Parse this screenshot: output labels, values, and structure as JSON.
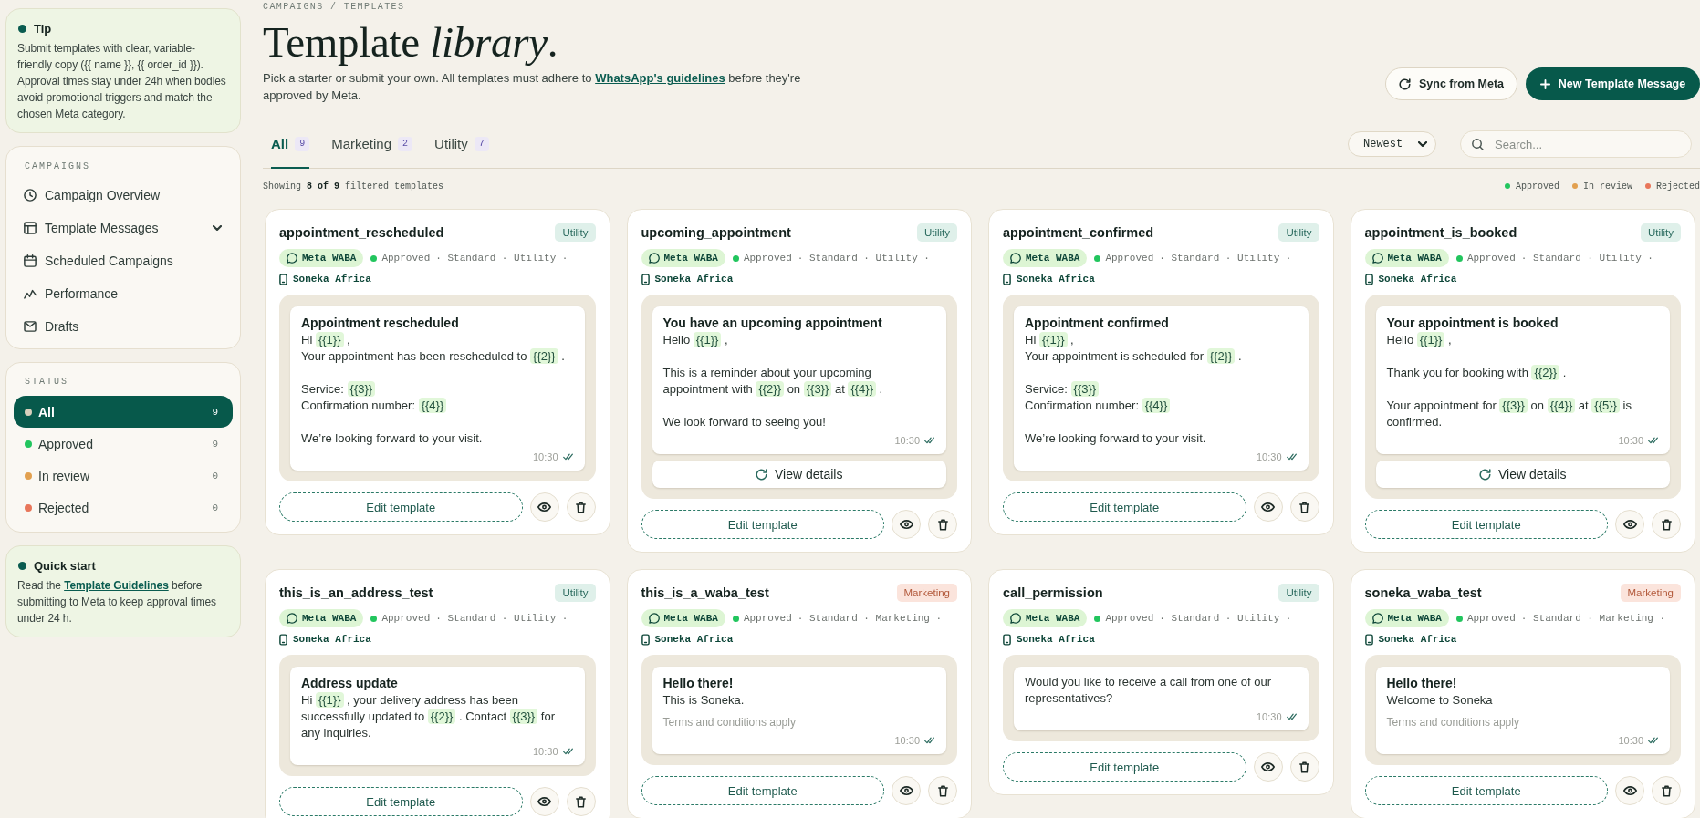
{
  "sidebar": {
    "tip": {
      "title": "Tip",
      "text": "Submit templates with clear, variable-friendly copy ({{ name }}, {{ order_id }}). Approval times stay under 24h when bodies avoid promotional triggers and match the chosen Meta category."
    },
    "campaigns": {
      "heading": "CAMPAIGNS",
      "items": [
        {
          "label": "Campaign Overview",
          "kind": "link"
        },
        {
          "label": "Template Messages",
          "kind": "group"
        },
        {
          "label": "Scheduled Campaigns",
          "kind": "link"
        },
        {
          "label": "Performance",
          "kind": "link"
        },
        {
          "label": "Drafts",
          "kind": "link"
        }
      ]
    },
    "status": {
      "heading": "STATUS",
      "items": [
        {
          "label": "All",
          "count": "9",
          "color": "#d8cfbb",
          "selected": true
        },
        {
          "label": "Approved",
          "count": "9",
          "color": "#22c55e",
          "selected": false
        },
        {
          "label": "In review",
          "count": "0",
          "color": "#e2a04f",
          "selected": false
        },
        {
          "label": "Rejected",
          "count": "0",
          "color": "#e8765a",
          "selected": false
        }
      ]
    },
    "quick_start": {
      "title": "Quick start",
      "before": "Read the",
      "link": "Template Guidelines",
      "after": "before submitting to Meta to keep approval times under 24 h."
    }
  },
  "header": {
    "breadcrumb": "CAMPAIGNS / TEMPLATES",
    "title": "Template *library*.",
    "description": {
      "before": "Pick a starter or submit your own. All templates must adhere to",
      "link": "WhatsApp's guidelines",
      "after": "before they're approved by Meta."
    },
    "buttons": [
      {
        "label": "Sync from Meta",
        "kind": "secondary"
      },
      {
        "label": "New Template Message",
        "kind": "primary"
      }
    ]
  },
  "tabs": [
    {
      "label": "All",
      "count": "9",
      "selected": true
    },
    {
      "label": "Marketing",
      "count": "2",
      "selected": false
    },
    {
      "label": "Utility",
      "count": "7",
      "selected": false
    }
  ],
  "sort": {
    "value": "Newest"
  },
  "search": {
    "placeholder": "Search..."
  },
  "summary": "Showing **8 of 9** filtered templates",
  "legend": [
    {
      "label": "Approved",
      "color": "#22c55e"
    },
    {
      "label": "In review",
      "color": "#e2a04f"
    },
    {
      "label": "Rejected",
      "color": "#e8765a"
    }
  ],
  "cards": [
    {
      "name": "appointment_rescheduled",
      "tag": {
        "label": "Utility",
        "kind": "utility"
      },
      "channel": "Meta WABA",
      "status": {
        "label": "Approved",
        "color": "#22c55e"
      },
      "details": "· Standard · Utility ·",
      "account": "Soneka Africa",
      "message": {
        "header": "Appointment rescheduled",
        "body": [
          [
            [
              "Hi ",
              {
                "var": "{{1}}"
              },
              " ,"
            ],
            [
              "Your appointment has been rescheduled to ",
              {
                "var": "{{2}}"
              },
              " ."
            ]
          ],
          [
            [
              "Service: ",
              {
                "var": "{{3}}"
              }
            ],
            [
              "Confirmation number: ",
              {
                "var": "{{4}}"
              }
            ]
          ],
          [
            [
              "We’re looking forward to your visit."
            ]
          ]
        ],
        "time": "10:30"
      },
      "edit_label": "Edit template"
    },
    {
      "name": "upcoming_appointment",
      "tag": {
        "label": "Utility",
        "kind": "utility"
      },
      "channel": "Meta WABA",
      "status": {
        "label": "Approved",
        "color": "#22c55e"
      },
      "details": "· Standard · Utility ·",
      "account": "Soneka Africa",
      "message": {
        "header": "You have an upcoming appointment",
        "body": [
          [
            [
              "Hello ",
              {
                "var": "{{1}}"
              },
              " ,"
            ]
          ],
          [
            [
              "This is a reminder about your upcoming appointment with ",
              {
                "var": "{{2}}"
              },
              " on ",
              {
                "var": "{{3}}"
              },
              " at ",
              {
                "var": "{{4}}"
              },
              " ."
            ]
          ],
          [
            [
              "We look forward to seeing you!"
            ]
          ]
        ],
        "time": "10:30",
        "button": "View details"
      },
      "edit_label": "Edit template"
    },
    {
      "name": "appointment_confirmed",
      "tag": {
        "label": "Utility",
        "kind": "utility"
      },
      "channel": "Meta WABA",
      "status": {
        "label": "Approved",
        "color": "#22c55e"
      },
      "details": "· Standard · Utility ·",
      "account": "Soneka Africa",
      "message": {
        "header": "Appointment confirmed",
        "body": [
          [
            [
              "Hi ",
              {
                "var": "{{1}}"
              },
              " ,"
            ],
            [
              "Your appointment is scheduled for ",
              {
                "var": "{{2}}"
              },
              " ."
            ]
          ],
          [
            [
              "Service: ",
              {
                "var": "{{3}}"
              }
            ],
            [
              "Confirmation number: ",
              {
                "var": "{{4}}"
              }
            ]
          ],
          [
            [
              "We’re looking forward to your visit."
            ]
          ]
        ],
        "time": "10:30"
      },
      "edit_label": "Edit template"
    },
    {
      "name": "appointment_is_booked",
      "tag": {
        "label": "Utility",
        "kind": "utility"
      },
      "channel": "Meta WABA",
      "status": {
        "label": "Approved",
        "color": "#22c55e"
      },
      "details": "· Standard · Utility ·",
      "account": "Soneka Africa",
      "message": {
        "header": "Your appointment is booked",
        "body": [
          [
            [
              "Hello ",
              {
                "var": "{{1}}"
              },
              " ,"
            ]
          ],
          [
            [
              "Thank you for booking with ",
              {
                "var": "{{2}}"
              },
              " ."
            ]
          ],
          [
            [
              "Your appointment for ",
              {
                "var": "{{3}}"
              },
              " on ",
              {
                "var": "{{4}}"
              },
              " at ",
              {
                "var": "{{5}}"
              },
              " is confirmed."
            ]
          ]
        ],
        "time": "10:30",
        "button": "View details"
      },
      "edit_label": "Edit template"
    },
    {
      "name": "this_is_an_address_test",
      "tag": {
        "label": "Utility",
        "kind": "utility"
      },
      "channel": "Meta WABA",
      "status": {
        "label": "Approved",
        "color": "#22c55e"
      },
      "details": "· Standard · Utility ·",
      "account": "Soneka Africa",
      "message": {
        "header": "Address update",
        "body": [
          [
            [
              "Hi ",
              {
                "var": "{{1}}"
              },
              " , your delivery address has been successfully updated to ",
              {
                "var": "{{2}}"
              },
              " . Contact ",
              {
                "var": "{{3}}"
              },
              " for any inquiries."
            ]
          ]
        ],
        "time": "10:30"
      },
      "edit_label": "Edit template"
    },
    {
      "name": "this_is_a_waba_test",
      "tag": {
        "label": "Marketing",
        "kind": "marketing"
      },
      "channel": "Meta WABA",
      "status": {
        "label": "Approved",
        "color": "#22c55e"
      },
      "details": "· Standard · Marketing ·",
      "account": "Soneka Africa",
      "message": {
        "header": "Hello there!",
        "body": [
          [
            [
              "This is Soneka."
            ]
          ]
        ],
        "footer": "Terms and conditions apply",
        "time": "10:30"
      },
      "edit_label": "Edit template"
    },
    {
      "name": "call_permission",
      "tag": {
        "label": "Utility",
        "kind": "utility"
      },
      "channel": "Meta WABA",
      "status": {
        "label": "Approved",
        "color": "#22c55e"
      },
      "details": "· Standard · Utility ·",
      "account": "Soneka Africa",
      "message": {
        "body": [
          [
            [
              "Would you like to receive a call from one of our representatives?"
            ]
          ]
        ],
        "time": "10:30"
      },
      "edit_label": "Edit template"
    },
    {
      "name": "soneka_waba_test",
      "tag": {
        "label": "Marketing",
        "kind": "marketing"
      },
      "channel": "Meta WABA",
      "status": {
        "label": "Approved",
        "color": "#22c55e"
      },
      "details": "· Standard · Marketing ·",
      "account": "Soneka Africa",
      "message": {
        "header": "Hello there!",
        "body": [
          [
            [
              "Welcome to Soneka"
            ]
          ]
        ],
        "footer": "Terms and conditions apply",
        "time": "10:30"
      },
      "edit_label": "Edit template"
    }
  ]
}
